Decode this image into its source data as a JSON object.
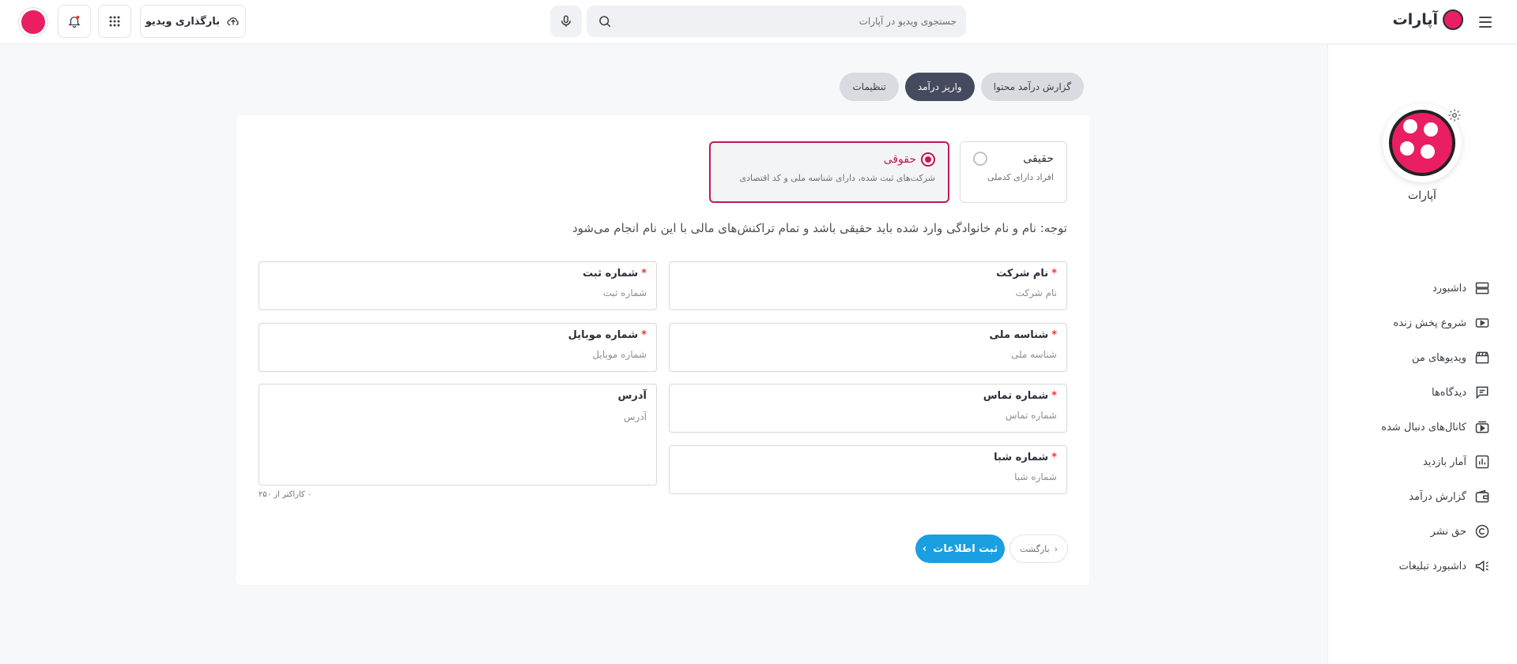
{
  "header": {
    "logo_text": "آپارات",
    "search_placeholder": "جستجوی ویدیو در آپارات",
    "upload_label": "بارگذاری ویدیو",
    "icons": [
      "menu-icon",
      "logo-icon",
      "search-icon",
      "mic-icon",
      "upload-cloud-icon",
      "apps-grid-icon",
      "bell-icon",
      "avatar"
    ]
  },
  "sidebar": {
    "channel_name": "آپارات",
    "items": [
      {
        "label": "داشبورد",
        "icon": "dashboard-icon"
      },
      {
        "label": "شروع پخش زنده",
        "icon": "live-icon"
      },
      {
        "label": "ویدیوهای من",
        "icon": "clapper-icon"
      },
      {
        "label": "دیدگاه‌ها",
        "icon": "comment-icon"
      },
      {
        "label": "کانال‌های دنبال شده",
        "icon": "followed-channels-icon"
      },
      {
        "label": "آمار بازدید",
        "icon": "stats-icon"
      },
      {
        "label": "گزارش درآمد",
        "icon": "wallet-icon"
      },
      {
        "label": "حق نشر",
        "icon": "copyright-icon"
      },
      {
        "label": "داشبورد تبلیغات",
        "icon": "megaphone-icon"
      }
    ]
  },
  "tabs": [
    {
      "label": "گزارش درآمد محتوا",
      "active": false
    },
    {
      "label": "واریز درآمد",
      "active": true
    },
    {
      "label": "تنظیمات",
      "active": false
    }
  ],
  "person_type": {
    "real": {
      "title": "حقیقی",
      "desc": "افراد دارای کدملی",
      "selected": false
    },
    "legal": {
      "title": "حقوقی",
      "desc": "شرکت‌های ثبت شده، دارای شناسه ملی و کد اقتصادی",
      "selected": true
    }
  },
  "note": "توجه: نام و نام خانوادگی وارد شده باید حقیقی باشد و تمام تراکنش‌های مالی با این نام انجام می‌شود",
  "form": {
    "company_name": {
      "label": "نام شرکت",
      "placeholder": "نام شرکت",
      "value": ""
    },
    "registration_no": {
      "label": "شماره ثبت",
      "placeholder": "شماره ثبت",
      "value": ""
    },
    "national_id": {
      "label": "شناسه ملی",
      "placeholder": "شناسه ملی",
      "value": ""
    },
    "mobile": {
      "label": "شماره موبایل",
      "placeholder": "شماره موبایل",
      "value": ""
    },
    "phone": {
      "label": "شماره تماس",
      "placeholder": "شماره تماس",
      "value": ""
    },
    "address": {
      "label": "آدرس",
      "placeholder": "آدرس",
      "value": ""
    },
    "sheba": {
      "label": "شماره شبا",
      "placeholder": "شماره شبا",
      "value": ""
    },
    "address_counter": "۰ کاراکتر از ۲۵۰"
  },
  "actions": {
    "submit": "ثبت اطلاعات",
    "back": "بازگشت"
  },
  "colors": {
    "brand": "#e91e63",
    "primary_button": "#1a9fe0",
    "active_tab": "#464a5e",
    "selected_border": "#c2185b"
  }
}
